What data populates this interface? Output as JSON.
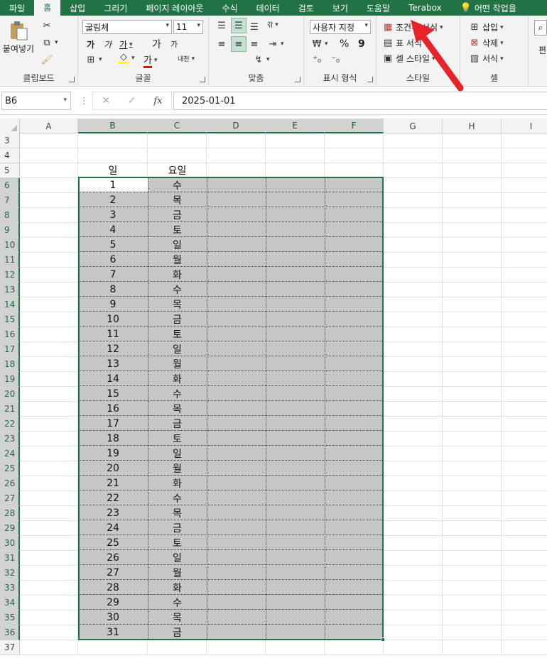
{
  "tabs": [
    "파일",
    "홈",
    "삽입",
    "그리기",
    "페이지 레이아웃",
    "수식",
    "데이터",
    "검토",
    "보기",
    "도움말",
    "Terabox",
    "어떤 작업을"
  ],
  "active_tab": "홈",
  "ribbon": {
    "clipboard": {
      "label": "클립보드",
      "paste": "붙여넣기"
    },
    "font": {
      "label": "글꼴",
      "font_name": "굴림체",
      "font_size": "11",
      "bold": "가",
      "italic": "가",
      "underline": "가",
      "grow": "가",
      "shrink": "가",
      "font_color": "가",
      "phonetic": "내천"
    },
    "alignment": {
      "label": "맞춤",
      "wrap": "갂"
    },
    "number": {
      "label": "표시 형식",
      "format": "사용자 지정",
      "currency": "₩",
      "percent": "%",
      "comma": "9"
    },
    "styles": {
      "label": "스타일",
      "conditional": "조건부 서식",
      "table": "표 서식",
      "cell_style": "셀 스타일"
    },
    "cells": {
      "label": "셀",
      "insert": "삽입",
      "delete": "삭제",
      "format": "서식"
    },
    "editing": {
      "label": "편"
    }
  },
  "formula_bar": {
    "name_box": "B6",
    "formula": "2025-01-01"
  },
  "columns": [
    "A",
    "B",
    "C",
    "D",
    "E",
    "F",
    "G",
    "H",
    "I"
  ],
  "row_numbers": [
    3,
    4,
    5,
    6,
    7,
    8,
    9,
    10,
    11,
    12,
    13,
    14,
    15,
    16,
    17,
    18,
    19,
    20,
    21,
    22,
    23,
    24,
    25,
    26,
    27,
    28,
    29,
    30,
    31,
    32,
    33,
    34,
    35,
    36,
    37
  ],
  "header_row": {
    "day": "일",
    "weekday": "요일"
  },
  "days": [
    "1",
    "2",
    "3",
    "4",
    "5",
    "6",
    "7",
    "8",
    "9",
    "10",
    "11",
    "12",
    "13",
    "14",
    "15",
    "16",
    "17",
    "18",
    "19",
    "20",
    "21",
    "22",
    "23",
    "24",
    "25",
    "26",
    "27",
    "28",
    "29",
    "30",
    "31"
  ],
  "weekdays": [
    "수",
    "목",
    "금",
    "토",
    "일",
    "월",
    "화",
    "수",
    "목",
    "금",
    "토",
    "일",
    "월",
    "화",
    "수",
    "목",
    "금",
    "토",
    "일",
    "월",
    "화",
    "수",
    "목",
    "금",
    "토",
    "일",
    "월",
    "화",
    "수",
    "목",
    "금"
  ],
  "colors": {
    "excel_green": "#217346",
    "selection_fill": "#c6c6c6",
    "arrow_red": "#e8232a"
  }
}
